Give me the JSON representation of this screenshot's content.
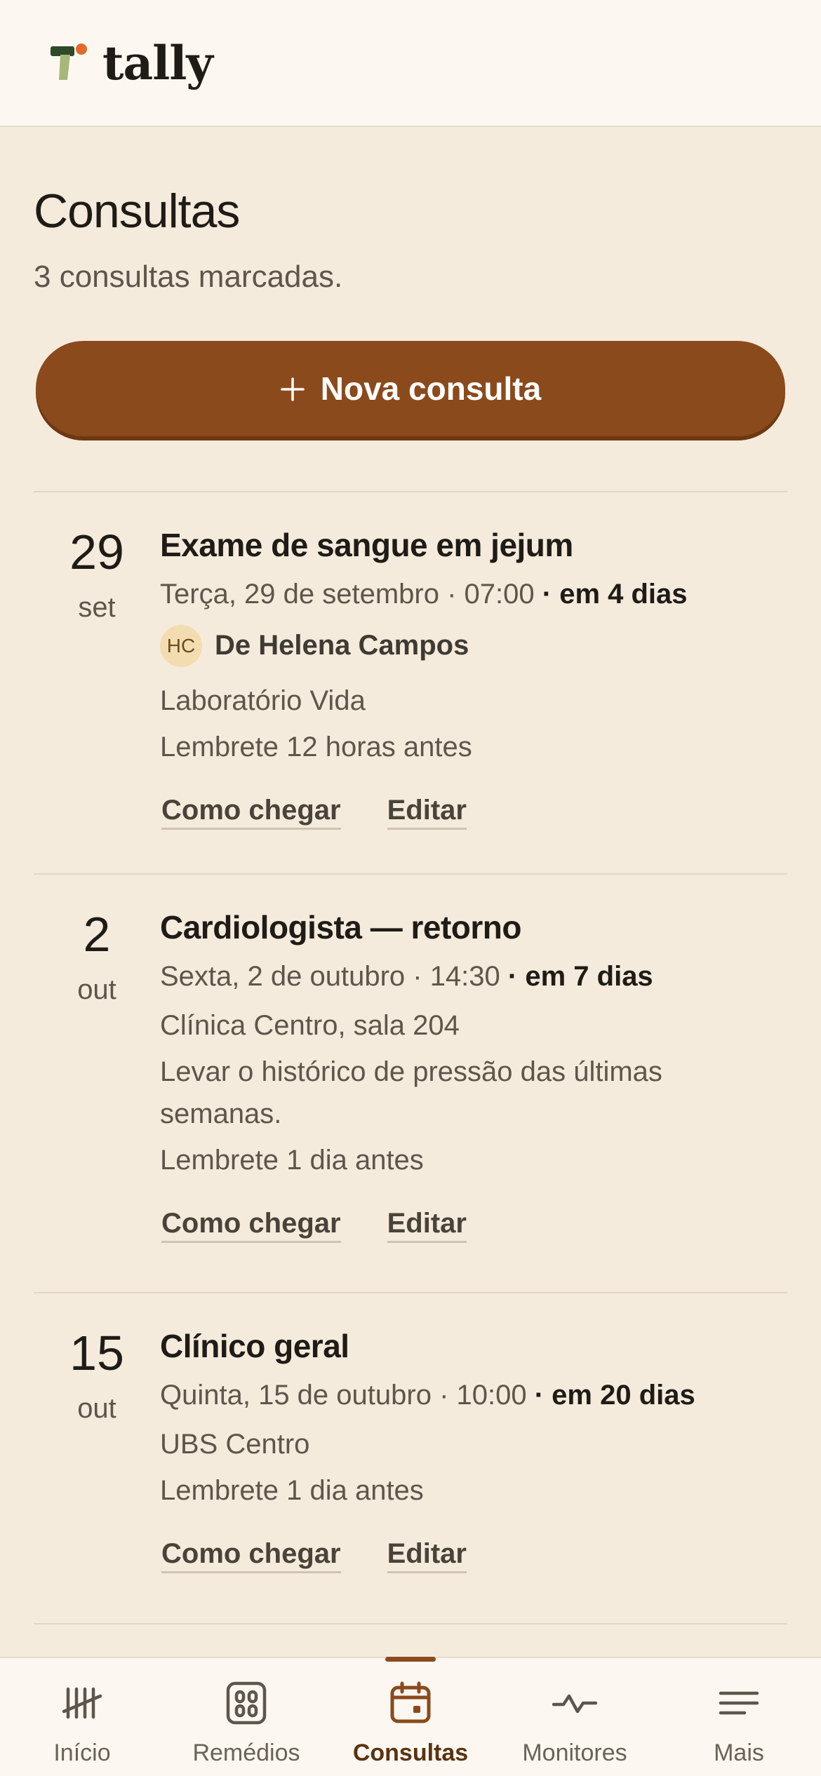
{
  "app": {
    "logo_text": "tally"
  },
  "page": {
    "title": "Consultas",
    "subtitle": "3 consultas marcadas.",
    "new_button_label": "Nova consulta"
  },
  "colors": {
    "accent": "#8b4a1c",
    "background": "#f5ebdc",
    "header": "#fcf8f1"
  },
  "appointments": [
    {
      "day": "29",
      "month": "set",
      "title": "Exame de sangue em jejum",
      "when": "Terça, 29 de setembro · 07:00",
      "relative": "· em 4 dias",
      "doctor_initials": "HC",
      "doctor_name": "De Helena Campos",
      "location": "Laboratório Vida",
      "reminder": "Lembrete 12 horas antes",
      "directions_label": "Como chegar",
      "edit_label": "Editar"
    },
    {
      "day": "2",
      "month": "out",
      "title": "Cardiologista — retorno",
      "when": "Sexta, 2 de outubro · 14:30",
      "relative": "· em 7 dias",
      "location": "Clínica Centro, sala 204",
      "note": "Levar o histórico de pressão das últimas semanas.",
      "reminder": "Lembrete 1 dia antes",
      "directions_label": "Como chegar",
      "edit_label": "Editar"
    },
    {
      "day": "15",
      "month": "out",
      "title": "Clínico geral",
      "when": "Quinta, 15 de outubro · 10:00",
      "relative": "· em 20 dias",
      "location": "UBS Centro",
      "reminder": "Lembrete 1 dia antes",
      "directions_label": "Como chegar",
      "edit_label": "Editar"
    }
  ],
  "nav": [
    {
      "label": "Início",
      "icon": "tally-marks-icon"
    },
    {
      "label": "Remédios",
      "icon": "pill-box-icon"
    },
    {
      "label": "Consultas",
      "icon": "calendar-icon",
      "active": true
    },
    {
      "label": "Monitores",
      "icon": "pulse-icon"
    },
    {
      "label": "Mais",
      "icon": "menu-icon"
    }
  ]
}
